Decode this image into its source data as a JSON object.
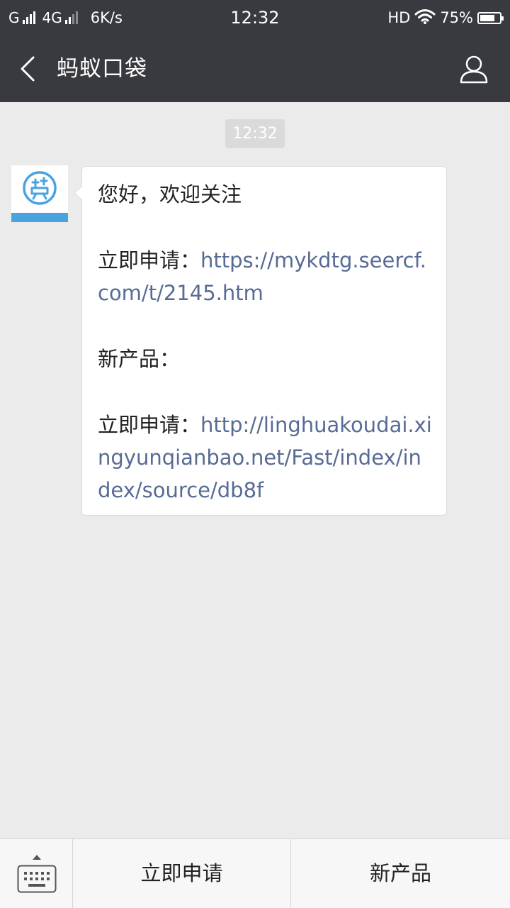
{
  "status_bar": {
    "carrier_1": "G",
    "carrier_2": "4G",
    "net_speed": "6K/s",
    "time": "12:32",
    "hd": "HD",
    "battery_text": "75%",
    "battery_level": 0.75
  },
  "nav": {
    "title": "蚂蚁口袋"
  },
  "chat": {
    "timestamp": "12:32",
    "message": {
      "greeting": "您好，欢迎关注",
      "apply_label_1": "立即申请：",
      "apply_link_1": "https://mykdtg.seercf.com/t/2145.htm",
      "new_product_label": "新产品：",
      "apply_label_2": "立即申请：",
      "apply_link_2": "http://linghuakoudai.xingyunqianbao.net/Fast/index/index/source/db8f"
    }
  },
  "bottom_menu": {
    "menu_1": "立即申请",
    "menu_2": "新产品"
  },
  "colors": {
    "header_bg": "#393a3f",
    "chat_bg": "#ebebeb",
    "link": "#576b95",
    "avatar_accent": "#4aa3e0"
  },
  "icons": [
    "signal-icon",
    "wifi-icon",
    "battery-icon",
    "back-chevron-icon",
    "profile-icon",
    "avatar-logo-icon",
    "keyboard-icon"
  ]
}
